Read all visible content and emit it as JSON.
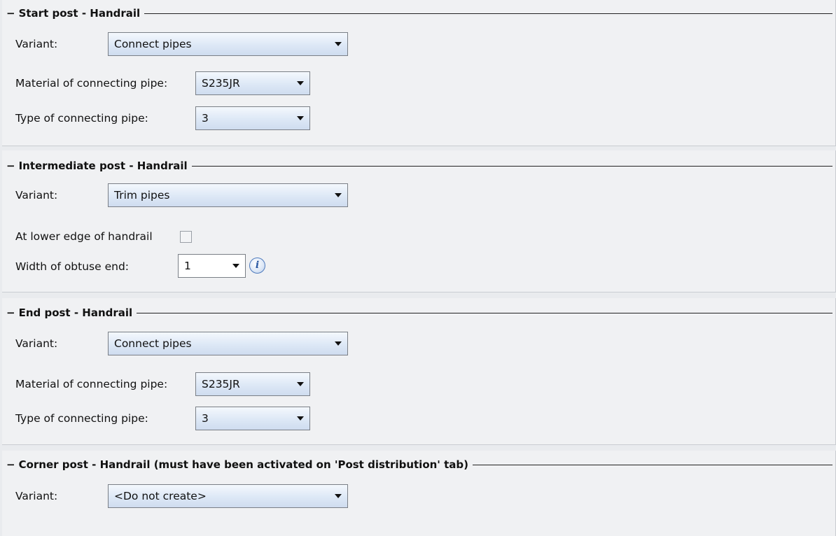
{
  "sections": {
    "start_post": {
      "collapse_symbol": "−",
      "title": "Start post - Handrail",
      "variant_label": "Variant:",
      "variant_value": "Connect pipes",
      "material_label": "Material of connecting pipe:",
      "material_value": "S235JR",
      "type_label": "Type of connecting pipe:",
      "type_value": "3"
    },
    "intermediate_post": {
      "collapse_symbol": "−",
      "title": "Intermediate post - Handrail",
      "variant_label": "Variant:",
      "variant_value": "Trim pipes",
      "lower_edge_label": "At lower edge of handrail",
      "lower_edge_checked": false,
      "width_label": "Width of obtuse end:",
      "width_value": "1",
      "info_symbol": "i"
    },
    "end_post": {
      "collapse_symbol": "−",
      "title": "End post - Handrail",
      "variant_label": "Variant:",
      "variant_value": "Connect pipes",
      "material_label": "Material of connecting pipe:",
      "material_value": "S235JR",
      "type_label": "Type of connecting pipe:",
      "type_value": "3"
    },
    "corner_post": {
      "collapse_symbol": "−",
      "title": "Corner post - Handrail (must have been activated on  'Post distribution' tab)",
      "variant_label": "Variant:",
      "variant_value": "<Do not create>"
    }
  },
  "icons": {
    "collapse": "collapse-icon",
    "dropdown": "chevron-down-icon",
    "info": "info-icon"
  }
}
